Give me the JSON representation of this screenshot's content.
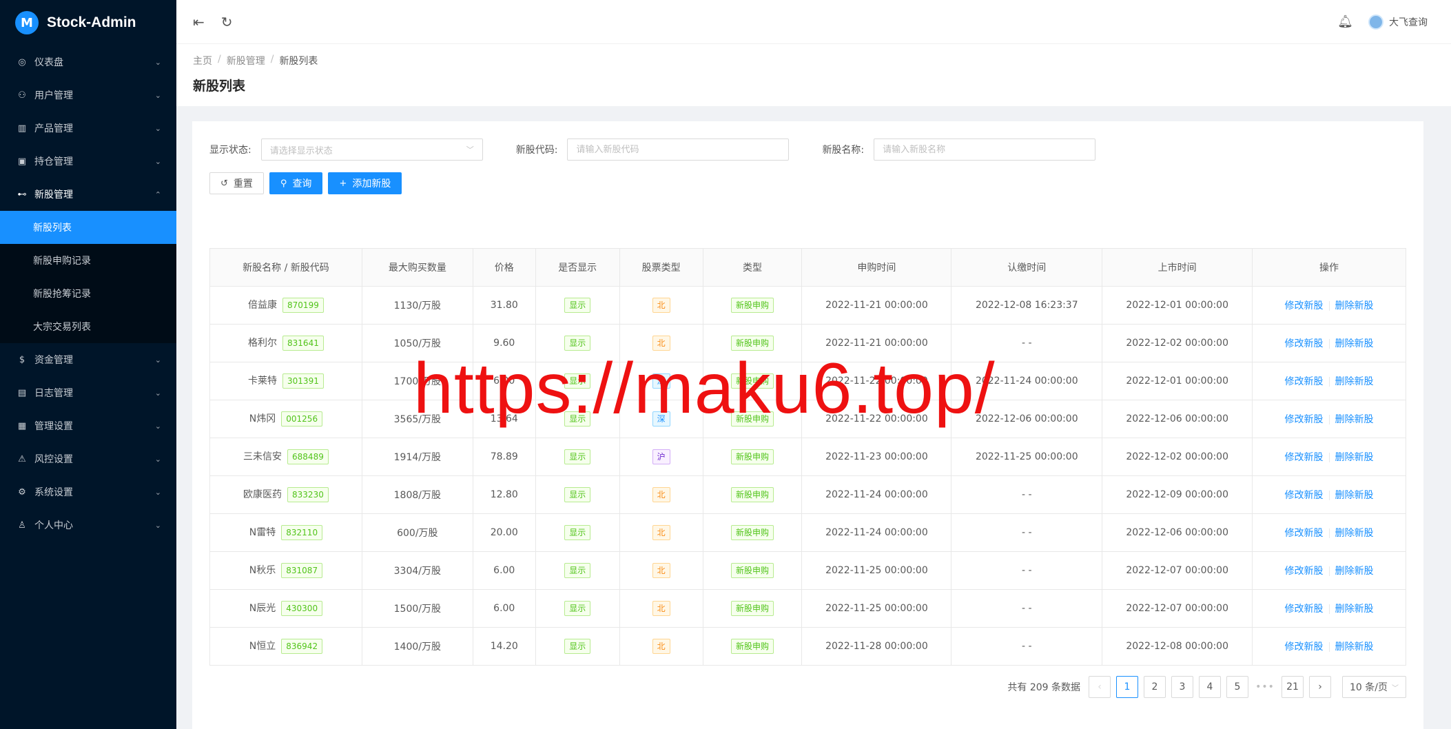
{
  "app": {
    "title": "Stock-Admin"
  },
  "sidebar": {
    "items": [
      {
        "icon": "dashboard-icon",
        "glyph": "◎",
        "label": "仪表盘"
      },
      {
        "icon": "user-icon",
        "glyph": "⚇",
        "label": "用户管理"
      },
      {
        "icon": "chart-icon",
        "glyph": "▥",
        "label": "产品管理"
      },
      {
        "icon": "position-icon",
        "glyph": "▣",
        "label": "持仓管理"
      },
      {
        "icon": "newstock-icon",
        "glyph": "⊷",
        "label": "新股管理"
      },
      {
        "icon": "fund-icon",
        "glyph": "$",
        "label": "资金管理"
      },
      {
        "icon": "log-icon",
        "glyph": "▤",
        "label": "日志管理"
      },
      {
        "icon": "admin-icon",
        "glyph": "▦",
        "label": "管理设置"
      },
      {
        "icon": "risk-icon",
        "glyph": "⚠",
        "label": "风控设置"
      },
      {
        "icon": "settings-icon",
        "glyph": "⚙",
        "label": "系统设置"
      },
      {
        "icon": "profile-icon",
        "glyph": "♙",
        "label": "个人中心"
      }
    ],
    "submenu": [
      "新股列表",
      "新股申购记录",
      "新股抢筹记录",
      "大宗交易列表"
    ]
  },
  "header": {
    "username": "大飞查询"
  },
  "breadcrumb": [
    "主页",
    "新股管理",
    "新股列表"
  ],
  "page_title": "新股列表",
  "filters": {
    "status_label": "显示状态:",
    "status_placeholder": "请选择显示状态",
    "code_label": "新股代码:",
    "code_placeholder": "请输入新股代码",
    "name_label": "新股名称:",
    "name_placeholder": "请输入新股名称"
  },
  "buttons": {
    "reset": "重置",
    "search": "查询",
    "add": "添加新股"
  },
  "table": {
    "columns": [
      "新股名称 / 新股代码",
      "最大购买数量",
      "价格",
      "是否显示",
      "股票类型",
      "类型",
      "申购时间",
      "认缴时间",
      "上市时间",
      "操作"
    ],
    "edit_label": "修改新股",
    "delete_label": "删除新股",
    "rows": [
      {
        "name": "倍益康",
        "code": "870199",
        "qty": "1130/万股",
        "price": "31.80",
        "show": "显示",
        "market": "北",
        "mcolor": "orange",
        "type": "新股申购",
        "apply": "2022-11-21 00:00:00",
        "pay": "2022-12-08 16:23:37",
        "list": "2022-12-01 00:00:00"
      },
      {
        "name": "格利尔",
        "code": "831641",
        "qty": "1050/万股",
        "price": "9.60",
        "show": "显示",
        "market": "北",
        "mcolor": "orange",
        "type": "新股申购",
        "apply": "2022-11-21 00:00:00",
        "pay": "- -",
        "list": "2022-12-02 00:00:00"
      },
      {
        "name": "卡莱特",
        "code": "301391",
        "qty": "1700/万股",
        "price": "6.00",
        "show": "显示",
        "market": "深",
        "mcolor": "blue",
        "type": "新股申购",
        "apply": "2022-11-22 00:00:00",
        "pay": "2022-11-24 00:00:00",
        "list": "2022-12-01 00:00:00"
      },
      {
        "name": "N炜冈",
        "code": "001256",
        "qty": "3565/万股",
        "price": "13.64",
        "show": "显示",
        "market": "深",
        "mcolor": "blue",
        "type": "新股申购",
        "apply": "2022-11-22 00:00:00",
        "pay": "2022-12-06 00:00:00",
        "list": "2022-12-06 00:00:00"
      },
      {
        "name": "三未信安",
        "code": "688489",
        "qty": "1914/万股",
        "price": "78.89",
        "show": "显示",
        "market": "沪",
        "mcolor": "purple",
        "type": "新股申购",
        "apply": "2022-11-23 00:00:00",
        "pay": "2022-11-25 00:00:00",
        "list": "2022-12-02 00:00:00"
      },
      {
        "name": "欧康医药",
        "code": "833230",
        "qty": "1808/万股",
        "price": "12.80",
        "show": "显示",
        "market": "北",
        "mcolor": "orange",
        "type": "新股申购",
        "apply": "2022-11-24 00:00:00",
        "pay": "- -",
        "list": "2022-12-09 00:00:00"
      },
      {
        "name": "N雷特",
        "code": "832110",
        "qty": "600/万股",
        "price": "20.00",
        "show": "显示",
        "market": "北",
        "mcolor": "orange",
        "type": "新股申购",
        "apply": "2022-11-24 00:00:00",
        "pay": "- -",
        "list": "2022-12-06 00:00:00"
      },
      {
        "name": "N秋乐",
        "code": "831087",
        "qty": "3304/万股",
        "price": "6.00",
        "show": "显示",
        "market": "北",
        "mcolor": "orange",
        "type": "新股申购",
        "apply": "2022-11-25 00:00:00",
        "pay": "- -",
        "list": "2022-12-07 00:00:00"
      },
      {
        "name": "N辰光",
        "code": "430300",
        "qty": "1500/万股",
        "price": "6.00",
        "show": "显示",
        "market": "北",
        "mcolor": "orange",
        "type": "新股申购",
        "apply": "2022-11-25 00:00:00",
        "pay": "- -",
        "list": "2022-12-07 00:00:00"
      },
      {
        "name": "N恒立",
        "code": "836942",
        "qty": "1400/万股",
        "price": "14.20",
        "show": "显示",
        "market": "北",
        "mcolor": "orange",
        "type": "新股申购",
        "apply": "2022-11-28 00:00:00",
        "pay": "- -",
        "list": "2022-12-08 00:00:00"
      }
    ]
  },
  "pagination": {
    "total_text": "共有 209 条数据",
    "pages": [
      "1",
      "2",
      "3",
      "4",
      "5"
    ],
    "ellipsis": "•••",
    "last_page": "21",
    "current": "1",
    "page_size": "10 条/页"
  },
  "watermark": "https://maku6.top/"
}
